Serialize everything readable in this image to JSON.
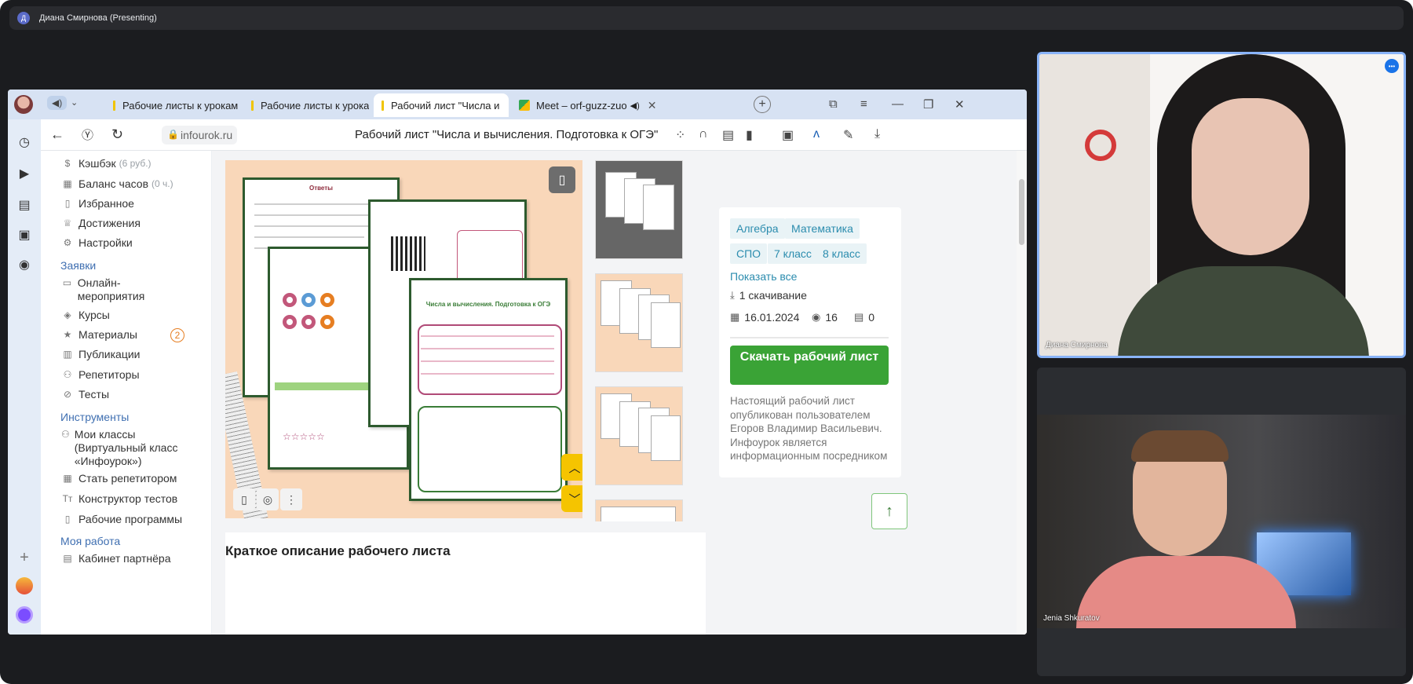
{
  "meet": {
    "presenter_initial": "Д",
    "presenter_label": "Диана Смирнова (Presenting)",
    "participants": [
      {
        "name": "Диана Смирнова"
      },
      {
        "name": "Jenia Shkuratov"
      }
    ]
  },
  "browser": {
    "tabs": [
      {
        "label": "Рабочие листы к урокам"
      },
      {
        "label": "Рабочие листы к урокам"
      },
      {
        "label": "Рабочий лист \"Числа и"
      },
      {
        "label": "Meet – orf-guzz-zuo"
      }
    ],
    "url": "infourok.ru",
    "page_title": "Рабочий лист \"Числа и вычисления. Подготовка к ОГЭ\""
  },
  "sidebar": {
    "items": [
      {
        "label": "Кэшбэк",
        "note": "(6 руб.)"
      },
      {
        "label": "Баланс часов",
        "note": "(0 ч.)"
      },
      {
        "label": "Избранное"
      },
      {
        "label": "Достижения"
      },
      {
        "label": "Настройки"
      }
    ],
    "section_requests": "Заявки",
    "requests": [
      {
        "label": "Онлайн-мероприятия"
      },
      {
        "label": "Курсы"
      },
      {
        "label": "Материалы",
        "badge": "2"
      },
      {
        "label": "Публикации"
      },
      {
        "label": "Репетиторы"
      },
      {
        "label": "Тесты"
      }
    ],
    "section_tools": "Инструменты",
    "tools": [
      {
        "label": "Мои классы (Виртуальный класс «Инфоурок»)"
      },
      {
        "label": "Стать репетитором"
      },
      {
        "label": "Конструктор тестов"
      },
      {
        "label": "Рабочие программы"
      }
    ],
    "section_work": "Моя работа",
    "work": [
      {
        "label": "Кабинет партнёра"
      }
    ]
  },
  "preview": {
    "sheet_answers_title": "Ответы",
    "sheet_main_title": "Числа и вычисления. Подготовка к ОГЭ"
  },
  "info": {
    "tags": [
      "Алгебра",
      "Математика",
      "СПО",
      "7 класс",
      "8 класс"
    ],
    "show_all": "Показать все",
    "downloads": "1 скачивание",
    "date": "16.01.2024",
    "views": "16",
    "comments": "0",
    "download_button": "Скачать рабочий лист",
    "description": "Настоящий рабочий лист опубликован пользователем Егоров Владимир Васильевич. Инфоурок является информационным посредником"
  },
  "summary_title": "Краткое описание рабочего листа",
  "colors": {
    "accent_green": "#3aa336",
    "link_blue": "#2b8cae",
    "section_blue": "#3f6fb1",
    "tabstrip": "#d7e2f3"
  }
}
